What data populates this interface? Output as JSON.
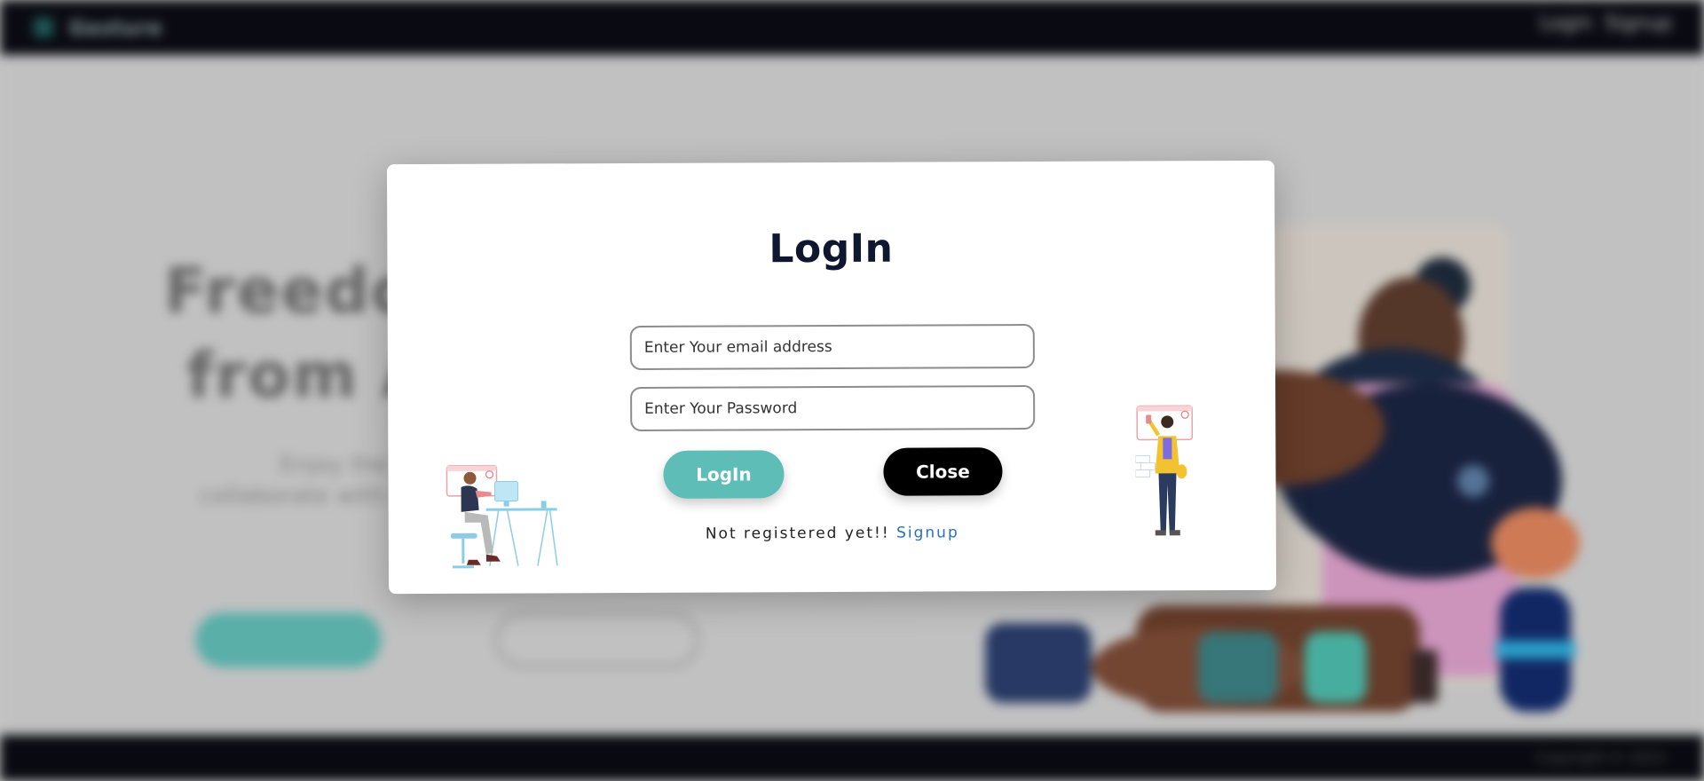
{
  "background": {
    "nav": {
      "logo_text": "Gesture",
      "links": [
        "Login",
        "Signup"
      ]
    },
    "hero": {
      "headline_line1": "Freedom",
      "headline_line2": "from A",
      "paragraph_line1": "Enjoy the fr",
      "paragraph_line2": "collaborate with fel"
    },
    "footer_text": "Copyright © 2023"
  },
  "modal": {
    "title": "LogIn",
    "email_placeholder": "Enter Your email address",
    "password_placeholder": "Enter Your Password",
    "login_label": "LogIn",
    "close_label": "Close",
    "not_registered_text": "Not registered yet!!",
    "signup_label": "Signup"
  },
  "colors": {
    "accent_teal": "#5fbdb8",
    "title_navy": "#0f1730",
    "link_blue": "#2a6fb8",
    "nav_dark": "#0b0c14"
  }
}
